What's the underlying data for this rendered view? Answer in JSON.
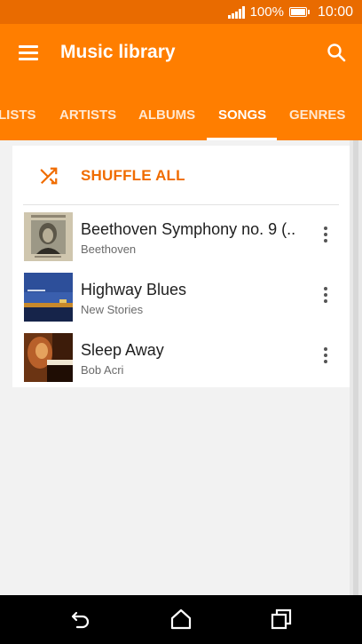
{
  "status_bar": {
    "battery_percent": "100%",
    "time": "10:00"
  },
  "toolbar": {
    "title": "Music library",
    "menu_icon": "hamburger-menu-icon",
    "search_icon": "search-icon"
  },
  "tabs": [
    {
      "label": "LISTS",
      "active": false
    },
    {
      "label": "ARTISTS",
      "active": false
    },
    {
      "label": "ALBUMS",
      "active": false
    },
    {
      "label": "SONGS",
      "active": true
    },
    {
      "label": "GENRES",
      "active": false
    }
  ],
  "shuffle": {
    "label": "SHUFFLE ALL",
    "icon": "shuffle-icon"
  },
  "songs": [
    {
      "title": "Beethoven Symphony no. 9 (..",
      "artist": "Beethoven"
    },
    {
      "title": "Highway Blues",
      "artist": "New Stories"
    },
    {
      "title": "Sleep Away",
      "artist": "Bob Acri"
    }
  ],
  "colors": {
    "status_bar": "#e96b00",
    "app_bar": "#ff7e00",
    "accent_text": "#f06c00",
    "background": "#f2f2f2"
  },
  "nav": {
    "back_icon": "back-icon",
    "home_icon": "home-icon",
    "recents_icon": "recent-apps-icon"
  }
}
